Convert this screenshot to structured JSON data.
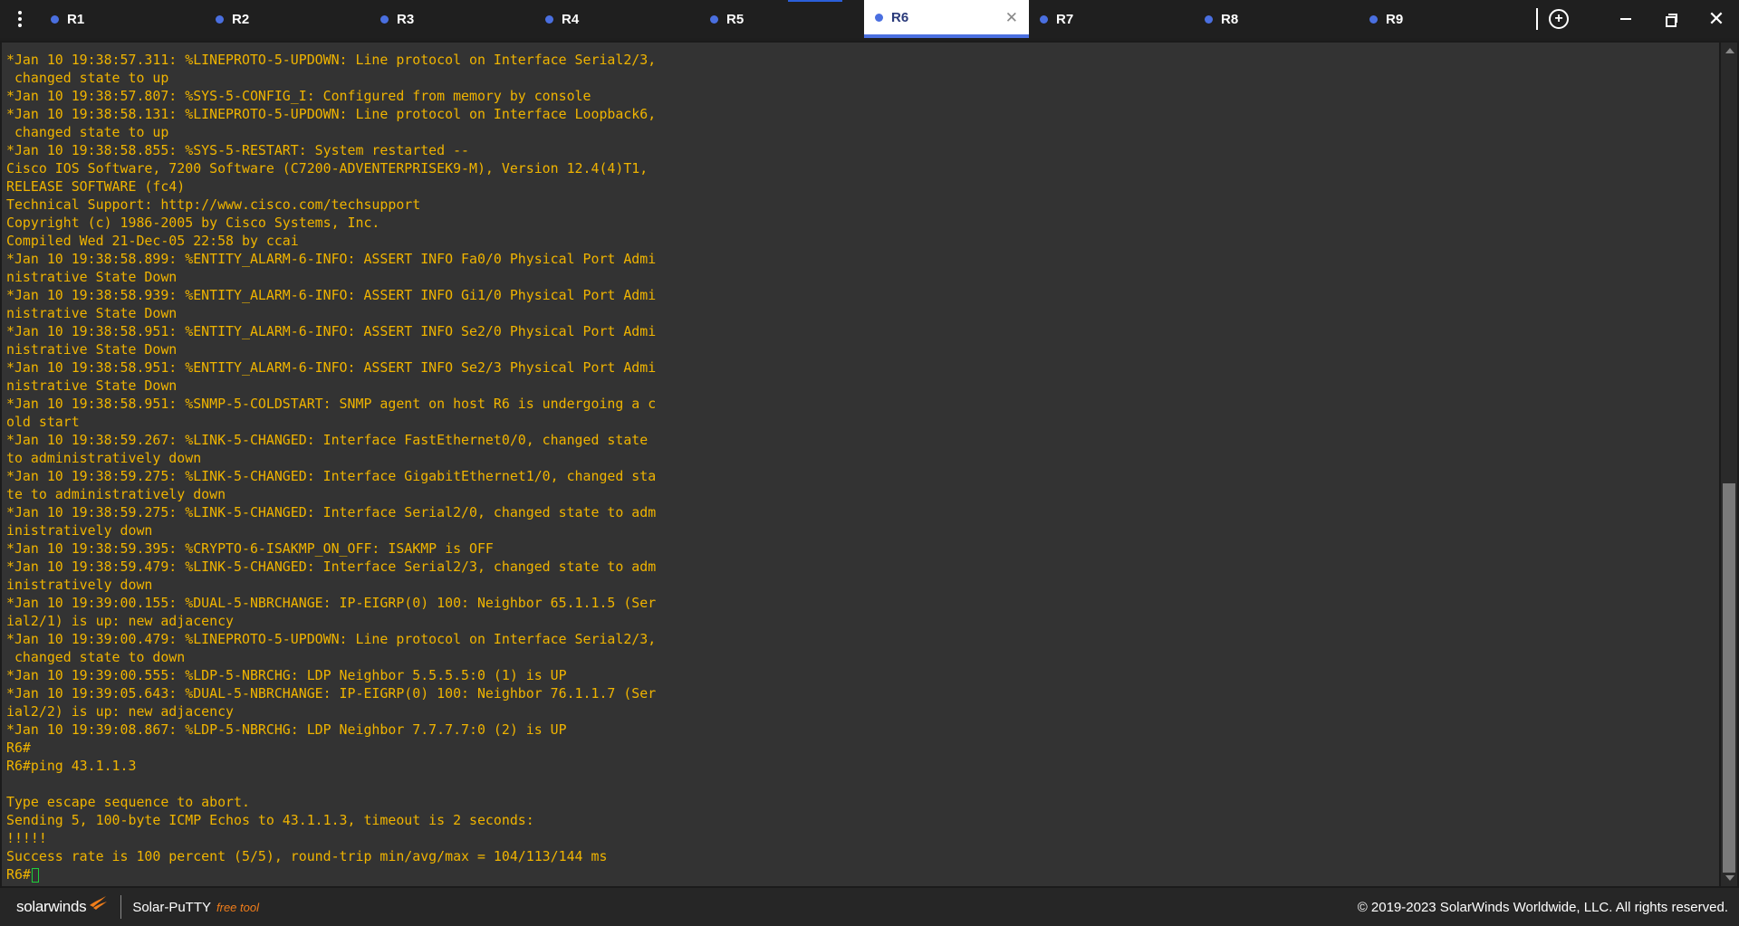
{
  "tabs": [
    {
      "label": "R1"
    },
    {
      "label": "R2"
    },
    {
      "label": "R3"
    },
    {
      "label": "R4"
    },
    {
      "label": "R5"
    },
    {
      "label": "R6",
      "active": true
    },
    {
      "label": "R7"
    },
    {
      "label": "R8"
    },
    {
      "label": "R9"
    }
  ],
  "window": {
    "add_tab": "+",
    "close": "✕"
  },
  "terminal": {
    "text": "*Jan 10 19:38:57.311: %LINEPROTO-5-UPDOWN: Line protocol on Interface Serial2/3,\n changed state to up\n*Jan 10 19:38:57.807: %SYS-5-CONFIG_I: Configured from memory by console\n*Jan 10 19:38:58.131: %LINEPROTO-5-UPDOWN: Line protocol on Interface Loopback6,\n changed state to up\n*Jan 10 19:38:58.855: %SYS-5-RESTART: System restarted --\nCisco IOS Software, 7200 Software (C7200-ADVENTERPRISEK9-M), Version 12.4(4)T1,\nRELEASE SOFTWARE (fc4)\nTechnical Support: http://www.cisco.com/techsupport\nCopyright (c) 1986-2005 by Cisco Systems, Inc.\nCompiled Wed 21-Dec-05 22:58 by ccai\n*Jan 10 19:38:58.899: %ENTITY_ALARM-6-INFO: ASSERT INFO Fa0/0 Physical Port Admi\nnistrative State Down\n*Jan 10 19:38:58.939: %ENTITY_ALARM-6-INFO: ASSERT INFO Gi1/0 Physical Port Admi\nnistrative State Down\n*Jan 10 19:38:58.951: %ENTITY_ALARM-6-INFO: ASSERT INFO Se2/0 Physical Port Admi\nnistrative State Down\n*Jan 10 19:38:58.951: %ENTITY_ALARM-6-INFO: ASSERT INFO Se2/3 Physical Port Admi\nnistrative State Down\n*Jan 10 19:38:58.951: %SNMP-5-COLDSTART: SNMP agent on host R6 is undergoing a c\nold start\n*Jan 10 19:38:59.267: %LINK-5-CHANGED: Interface FastEthernet0/0, changed state\nto administratively down\n*Jan 10 19:38:59.275: %LINK-5-CHANGED: Interface GigabitEthernet1/0, changed sta\nte to administratively down\n*Jan 10 19:38:59.275: %LINK-5-CHANGED: Interface Serial2/0, changed state to adm\ninistratively down\n*Jan 10 19:38:59.395: %CRYPTO-6-ISAKMP_ON_OFF: ISAKMP is OFF\n*Jan 10 19:38:59.479: %LINK-5-CHANGED: Interface Serial2/3, changed state to adm\ninistratively down\n*Jan 10 19:39:00.155: %DUAL-5-NBRCHANGE: IP-EIGRP(0) 100: Neighbor 65.1.1.5 (Ser\nial2/1) is up: new adjacency\n*Jan 10 19:39:00.479: %LINEPROTO-5-UPDOWN: Line protocol on Interface Serial2/3,\n changed state to down\n*Jan 10 19:39:00.555: %LDP-5-NBRCHG: LDP Neighbor 5.5.5.5:0 (1) is UP\n*Jan 10 19:39:05.643: %DUAL-5-NBRCHANGE: IP-EIGRP(0) 100: Neighbor 76.1.1.7 (Ser\nial2/2) is up: new adjacency\n*Jan 10 19:39:08.867: %LDP-5-NBRCHG: LDP Neighbor 7.7.7.7:0 (2) is UP\nR6#\nR6#ping 43.1.1.3\n\nType escape sequence to abort.\nSending 5, 100-byte ICMP Echos to 43.1.1.3, timeout is 2 seconds:\n!!!!!\nSuccess rate is 100 percent (5/5), round-trip min/avg/max = 104/113/144 ms\n",
    "prompt": "R6#"
  },
  "footer": {
    "brand": "solarwinds",
    "product": "Solar-PuTTY",
    "tag": "free tool",
    "copyright": "© 2019-2023 SolarWinds Worldwide, LLC. All rights reserved."
  },
  "colors": {
    "terminal_bg": "#333333",
    "terminal_fg": "#f0b400",
    "accent": "#4a6fe0",
    "cursor": "#1fce3a",
    "free_tool": "#f07d1a"
  }
}
